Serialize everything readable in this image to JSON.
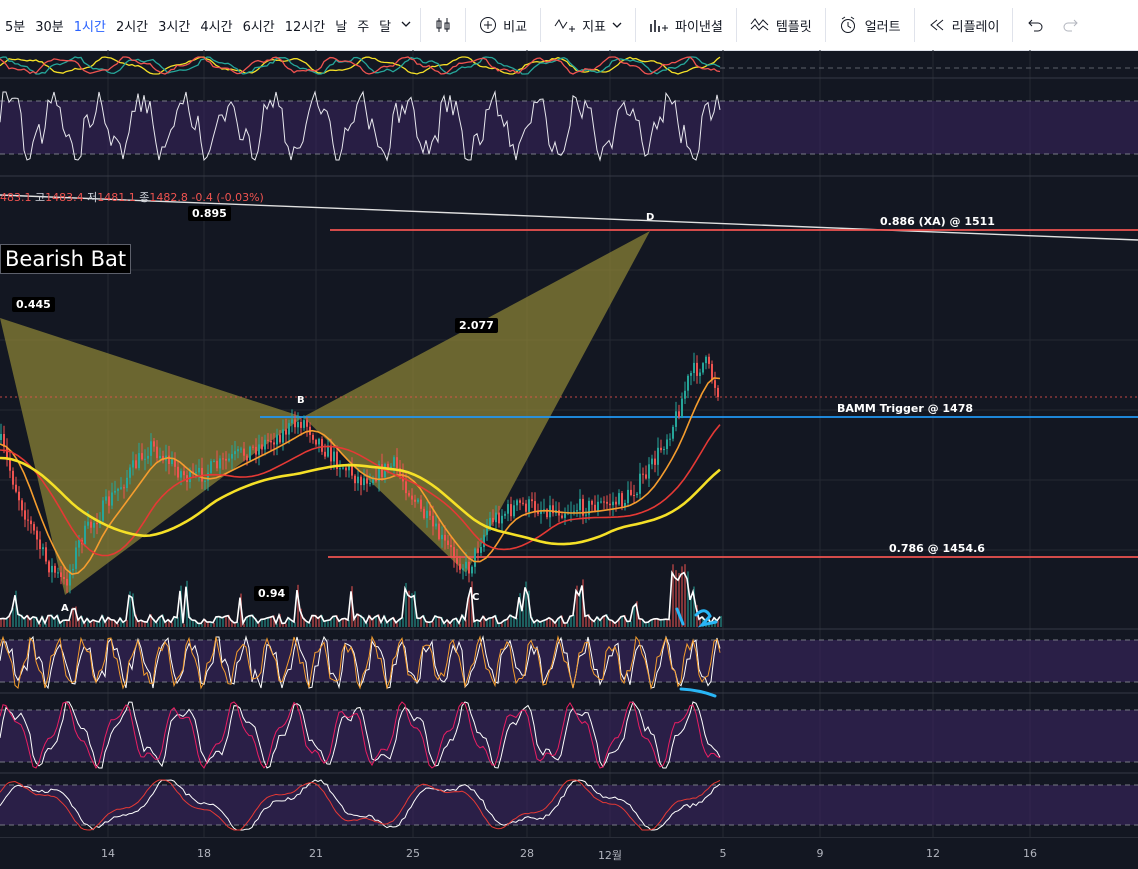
{
  "toolbar": {
    "timeframes": [
      {
        "label": "5분",
        "active": false
      },
      {
        "label": "30분",
        "active": false
      },
      {
        "label": "1시간",
        "active": true
      },
      {
        "label": "2시간",
        "active": false
      },
      {
        "label": "3시간",
        "active": false
      },
      {
        "label": "4시간",
        "active": false
      },
      {
        "label": "6시간",
        "active": false
      },
      {
        "label": "12시간",
        "active": false
      },
      {
        "label": "날",
        "active": false
      },
      {
        "label": "주",
        "active": false
      },
      {
        "label": "달",
        "active": false
      }
    ],
    "compare_label": "비교",
    "indicators_label": "지표",
    "pine_label": "파이낸셜",
    "template_label": "템플릿",
    "alert_label": "얼러트",
    "replay_label": "리플레이"
  },
  "ohlc": {
    "open_value": "483.1",
    "high_key": "고",
    "high_value": "1483.4",
    "low_key": "저",
    "low_value": "1481.1",
    "close_key": "종",
    "close_value": "1482.8",
    "change": "-0.4 (-0.03%)"
  },
  "pattern": {
    "title": "Bearish Bat",
    "ratios": {
      "xb": "0.445",
      "bd": "2.077",
      "ac": "0.94",
      "xd": "0.895"
    },
    "points": {
      "a": "A",
      "b": "B",
      "c": "C",
      "d": "D"
    }
  },
  "levels": {
    "xa": "0.886 (XA) @ 1511",
    "bamm": "BAMM Trigger @ 1478",
    "fib": "0.786 @ 1454.6"
  },
  "annotations": {
    "wave_marks": "1 2"
  },
  "colors": {
    "background": "#131722",
    "pattern_fill": "#8a8235",
    "level_red": "#ef5350",
    "bamm_blue": "#2196f3",
    "oscillator_band": "#3b2560",
    "sma_yellow": "#f5e027",
    "ema_orange": "#f59d2e"
  },
  "axis": {
    "dates": [
      "14",
      "18",
      "21",
      "25",
      "28",
      "12월",
      "5",
      "9",
      "12",
      "16"
    ]
  }
}
